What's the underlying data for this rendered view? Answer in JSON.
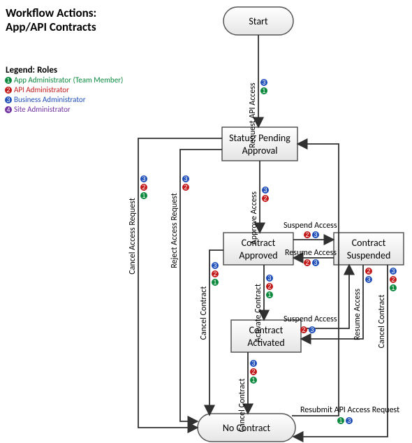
{
  "title": {
    "line1": "Workflow Actions:",
    "line2": " App/API Contracts"
  },
  "legend": {
    "heading": "Legend: Roles",
    "items": [
      {
        "num": "1",
        "label": "App Administrator (Team Member)",
        "color": "#0B8A3E"
      },
      {
        "num": "2",
        "label": "API Administrator",
        "color": "#C21A1A"
      },
      {
        "num": "3",
        "label": "Business Administrator",
        "color": "#1F4FB8"
      },
      {
        "num": "4",
        "label": "Site Administrator",
        "color": "#7030A0"
      }
    ]
  },
  "roleColors": {
    "1": "#0B8A3E",
    "2": "#C21A1A",
    "3": "#1F4FB8",
    "4": "#7030A0"
  },
  "nodes": {
    "start": {
      "label": "Start"
    },
    "pending": {
      "line1": "Status: Pending",
      "line2": "Approval"
    },
    "approved": {
      "line1": "Contract",
      "line2": "Approved"
    },
    "suspended": {
      "line1": "Contract",
      "line2": "Suspended"
    },
    "activated": {
      "line1": "Contract",
      "line2": "Activated"
    },
    "nocontract": {
      "label": "No Contract"
    }
  },
  "edges": {
    "requestApi": {
      "label": "Request API Access",
      "roles": [
        "3",
        "1"
      ]
    },
    "approveAccess": {
      "label": "Approve Access",
      "roles": [
        "3",
        "2"
      ]
    },
    "rejectAccess": {
      "label": "Reject Access Request",
      "roles": [
        "3",
        "2"
      ]
    },
    "cancelAccess": {
      "label": "Cancel Access Request",
      "roles": [
        "3",
        "2",
        "1"
      ]
    },
    "suspendA": {
      "label": "Suspend Access",
      "roles": [
        "2",
        "3"
      ]
    },
    "resumeA": {
      "label": "Resume Access",
      "roles": [
        "2",
        "3"
      ]
    },
    "activate": {
      "label": "Activate Contract",
      "roles": [
        "3",
        "2",
        "1"
      ]
    },
    "cancelApproved": {
      "label": "Cancel Contract",
      "roles": [
        "3",
        "2",
        "1"
      ]
    },
    "suspendB": {
      "label": "Suspend Access",
      "roles": [
        "2",
        "3"
      ]
    },
    "resumeB": {
      "label": "Resume Access",
      "roles": [
        "2",
        "3"
      ]
    },
    "cancelSuspended": {
      "label": "Cancel Contract",
      "roles": [
        "3",
        "2",
        "1"
      ]
    },
    "cancelActivated": {
      "label": "Cancel Contract",
      "roles": [
        "3",
        "2",
        "1"
      ]
    },
    "resubmit": {
      "label": "Resubmit API Access Request",
      "roles": [
        "1",
        "3"
      ]
    }
  }
}
